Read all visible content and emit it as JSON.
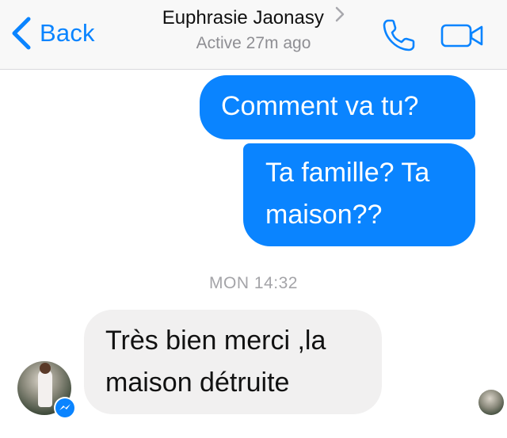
{
  "header": {
    "back_label": "Back",
    "contact_name": "Euphrasie Jaonasy",
    "status": "Active 27m ago",
    "icons": [
      "chevron-left-icon",
      "chevron-right-icon",
      "phone-icon",
      "video-camera-icon"
    ]
  },
  "messages": [
    {
      "direction": "outgoing",
      "text": "Comment va tu?"
    },
    {
      "direction": "outgoing",
      "text": "Ta famille? Ta maison??"
    },
    {
      "direction": "incoming",
      "text": "Très bien merci ,la maison détruite"
    }
  ],
  "timestamp": "MON 14:32",
  "colors": {
    "accent": "#0a84ff",
    "incoming_bubble": "#f1f0f0",
    "navbar_bg": "#f8f8f8",
    "secondary_text": "#8e8e93"
  }
}
